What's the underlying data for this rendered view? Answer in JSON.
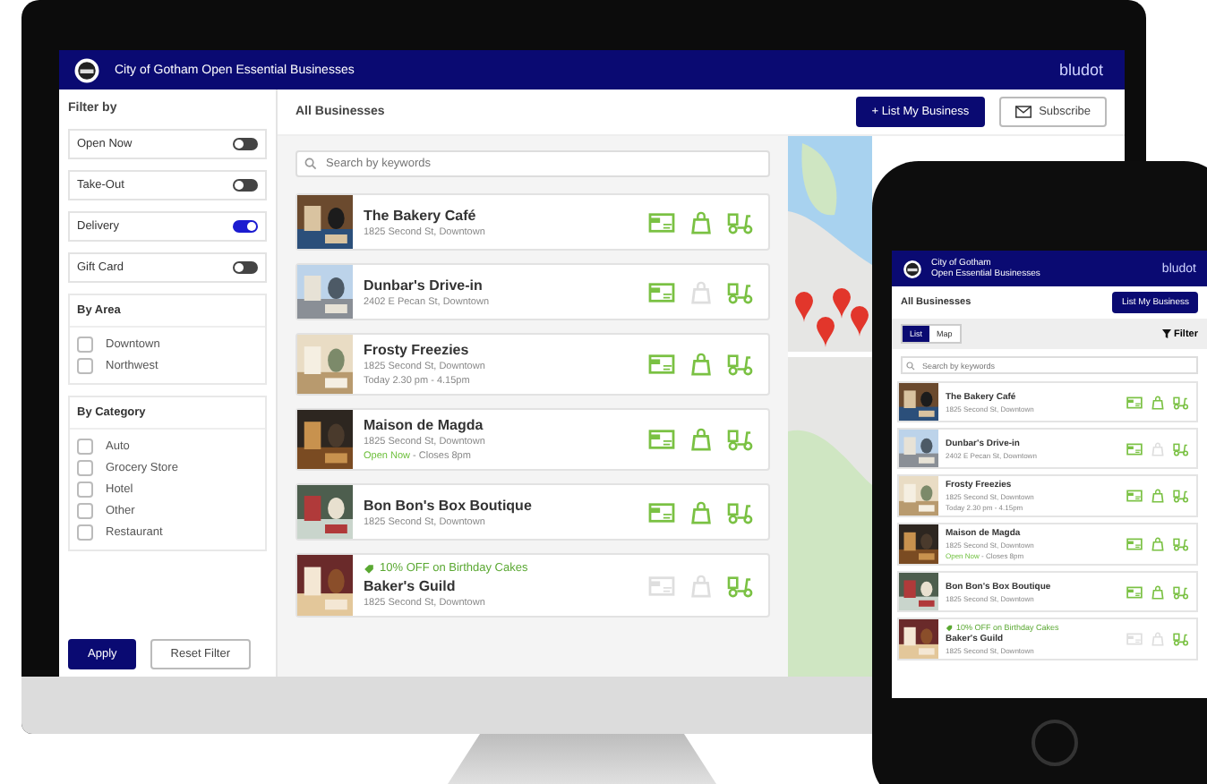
{
  "desktop": {
    "header": {
      "title": "City of Gotham Open Essential Businesses",
      "brand": "bludot"
    },
    "filter": {
      "title": "Filter by",
      "toggles": [
        {
          "label": "Open Now",
          "on": false
        },
        {
          "label": "Take-Out",
          "on": false
        },
        {
          "label": "Delivery",
          "on": true
        },
        {
          "label": "Gift Card",
          "on": false
        }
      ],
      "groups": [
        {
          "title": "By Area",
          "options": [
            {
              "label": "Downtown",
              "checked": false
            },
            {
              "label": "Northwest",
              "checked": false
            }
          ]
        },
        {
          "title": "By Category",
          "options": [
            {
              "label": "Auto",
              "checked": false
            },
            {
              "label": "Grocery Store",
              "checked": false
            },
            {
              "label": "Hotel",
              "checked": false
            },
            {
              "label": "Other",
              "checked": false
            },
            {
              "label": "Restaurant",
              "checked": false
            }
          ]
        }
      ],
      "buttons": [
        {
          "label": "Apply",
          "kind": "primary"
        },
        {
          "label": "Reset Filter",
          "kind": "secondary"
        }
      ]
    },
    "list_title": "All Businesses",
    "actions": [
      {
        "label": "+ List My Business",
        "kind": "primary"
      },
      {
        "label": "Subscribe",
        "kind": "mail"
      }
    ],
    "search": {
      "placeholder": "Search by keywords"
    },
    "businesses": [
      {
        "name": "The Bakery Café",
        "address": "1825 Second St, Downtown",
        "amenities": [
          {
            "kind": "gift_card",
            "on": true
          },
          {
            "kind": "takeout",
            "on": true
          },
          {
            "kind": "delivery",
            "on": true
          }
        ]
      },
      {
        "name": "Dunbar's Drive-in",
        "address": "2402 E Pecan St, Downtown",
        "amenities": [
          {
            "kind": "gift_card",
            "on": true
          },
          {
            "kind": "takeout",
            "on": false
          },
          {
            "kind": "delivery",
            "on": true
          }
        ]
      },
      {
        "name": "Frosty Freezies",
        "address": "1825 Second St, Downtown",
        "hours": "Today  2.30 pm - 4.15pm",
        "amenities": [
          {
            "kind": "gift_card",
            "on": true
          },
          {
            "kind": "takeout",
            "on": true
          },
          {
            "kind": "delivery",
            "on": true
          }
        ]
      },
      {
        "name": "Maison de Magda",
        "address": "1825 Second St, Downtown",
        "open_label": "Open Now",
        "closes": "- Closes 8pm",
        "amenities": [
          {
            "kind": "gift_card",
            "on": true
          },
          {
            "kind": "takeout",
            "on": true
          },
          {
            "kind": "delivery",
            "on": true
          }
        ]
      },
      {
        "name": "Bon Bon's Box Boutique",
        "address": "1825 Second St, Downtown",
        "amenities": [
          {
            "kind": "gift_card",
            "on": true
          },
          {
            "kind": "takeout",
            "on": true
          },
          {
            "kind": "delivery",
            "on": true
          }
        ]
      },
      {
        "name": "Baker's Guild",
        "address": "1825 Second St, Downtown",
        "promo": "10% OFF on Birthday Cakes",
        "amenities": [
          {
            "kind": "gift_card",
            "on": false
          },
          {
            "kind": "takeout",
            "on": false
          },
          {
            "kind": "delivery",
            "on": true
          }
        ]
      }
    ]
  },
  "mobile": {
    "header": {
      "title_lines": [
        "City of Gotham",
        "Open Essential Businesses"
      ],
      "brand": "bludot"
    },
    "list_title": "All Businesses",
    "action": "List My Business",
    "views": [
      {
        "label": "List",
        "selected": true
      },
      {
        "label": "Map",
        "selected": false
      }
    ],
    "filter": "Filter",
    "search": {
      "placeholder": "Search by keywords"
    },
    "businesses": [
      {
        "name": "The Bakery Café",
        "address": "1825 Second St, Downtown",
        "amenities": [
          {
            "kind": "gift_card",
            "on": true
          },
          {
            "kind": "takeout",
            "on": true
          },
          {
            "kind": "delivery",
            "on": true
          }
        ]
      },
      {
        "name": "Dunbar's Drive-in",
        "address": "2402 E Pecan St, Downtown",
        "amenities": [
          {
            "kind": "gift_card",
            "on": true
          },
          {
            "kind": "takeout",
            "on": false
          },
          {
            "kind": "delivery",
            "on": true
          }
        ]
      },
      {
        "name": "Frosty Freezies",
        "address": "1825 Second St, Downtown",
        "hours": "Today  2.30 pm - 4.15pm",
        "amenities": [
          {
            "kind": "gift_card",
            "on": true
          },
          {
            "kind": "takeout",
            "on": true
          },
          {
            "kind": "delivery",
            "on": true
          }
        ]
      },
      {
        "name": "Maison de Magda",
        "address": "1825 Second St, Downtown",
        "open_label": "Open Now",
        "closes": "- Closes 8pm",
        "amenities": [
          {
            "kind": "gift_card",
            "on": true
          },
          {
            "kind": "takeout",
            "on": true
          },
          {
            "kind": "delivery",
            "on": true
          }
        ]
      },
      {
        "name": "Bon Bon's Box Boutique",
        "address": "1825 Second St, Downtown",
        "amenities": [
          {
            "kind": "gift_card",
            "on": true
          },
          {
            "kind": "takeout",
            "on": true
          },
          {
            "kind": "delivery",
            "on": true
          }
        ]
      },
      {
        "name": "Baker's Guild",
        "address": "1825 Second St, Downtown",
        "promo": "10% OFF on Birthday Cakes",
        "amenities": [
          {
            "kind": "gift_card",
            "on": false
          },
          {
            "kind": "takeout",
            "on": false
          },
          {
            "kind": "delivery",
            "on": true
          }
        ]
      }
    ]
  }
}
